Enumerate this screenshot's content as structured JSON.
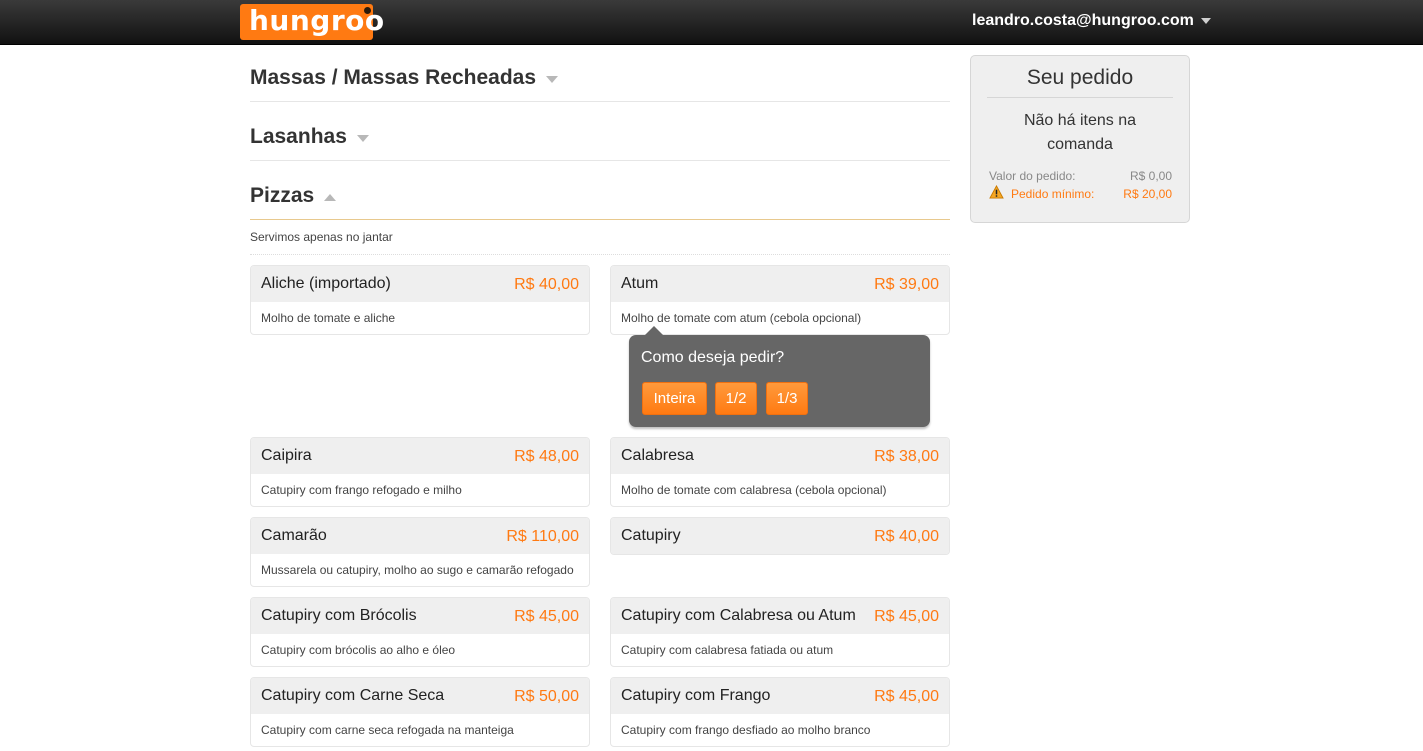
{
  "header": {
    "logo_text": "hungroo",
    "user_email": "leandro.costa@hungroo.com",
    "brand_color": "#ff7a12"
  },
  "categories": [
    {
      "title": "Massas / Massas Recheadas",
      "state": "collapsed"
    },
    {
      "title": "Lasanhas",
      "state": "collapsed"
    },
    {
      "title": "Pizzas",
      "state": "expanded"
    }
  ],
  "pizzas": {
    "subtitle": "Servimos apenas no jantar",
    "items": [
      {
        "name": "Aliche (importado)",
        "price": "R$ 40,00",
        "desc": "Molho de tomate e aliche"
      },
      {
        "name": "Atum",
        "price": "R$ 39,00",
        "desc": "Molho de tomate com atum (cebola opcional)"
      },
      {
        "name": "Caipira",
        "price": "R$ 48,00",
        "desc": "Catupiry com frango refogado e milho"
      },
      {
        "name": "Calabresa",
        "price": "R$ 38,00",
        "desc": "Molho de tomate com calabresa (cebola opcional)"
      },
      {
        "name": "Camarão",
        "price": "R$ 110,00",
        "desc": "Mussarela ou catupiry, molho ao sugo e camarão refogado"
      },
      {
        "name": "Catupiry",
        "price": "R$ 40,00",
        "desc": ""
      },
      {
        "name": "Catupiry com Brócolis",
        "price": "R$ 45,00",
        "desc": "Catupiry com brócolis ao alho e óleo"
      },
      {
        "name": "Catupiry com Calabresa ou Atum",
        "price": "R$ 45,00",
        "desc": "Catupiry com calabresa fatiada ou atum"
      },
      {
        "name": "Catupiry com Carne Seca",
        "price": "R$ 50,00",
        "desc": "Catupiry com carne seca refogada na manteiga"
      },
      {
        "name": "Catupiry com Frango",
        "price": "R$ 45,00",
        "desc": "Catupiry com frango desfiado ao molho branco"
      }
    ]
  },
  "popover": {
    "title": "Como deseja pedir?",
    "options": [
      "Inteira",
      "1/2",
      "1/3"
    ]
  },
  "order": {
    "title": "Seu pedido",
    "empty_text": "Não há itens na comanda",
    "value_label": "Valor do pedido:",
    "value": "R$ 0,00",
    "min_label": "Pedido mínimo:",
    "min_value": "R$ 20,00",
    "warning_color": "#ff7a12"
  }
}
